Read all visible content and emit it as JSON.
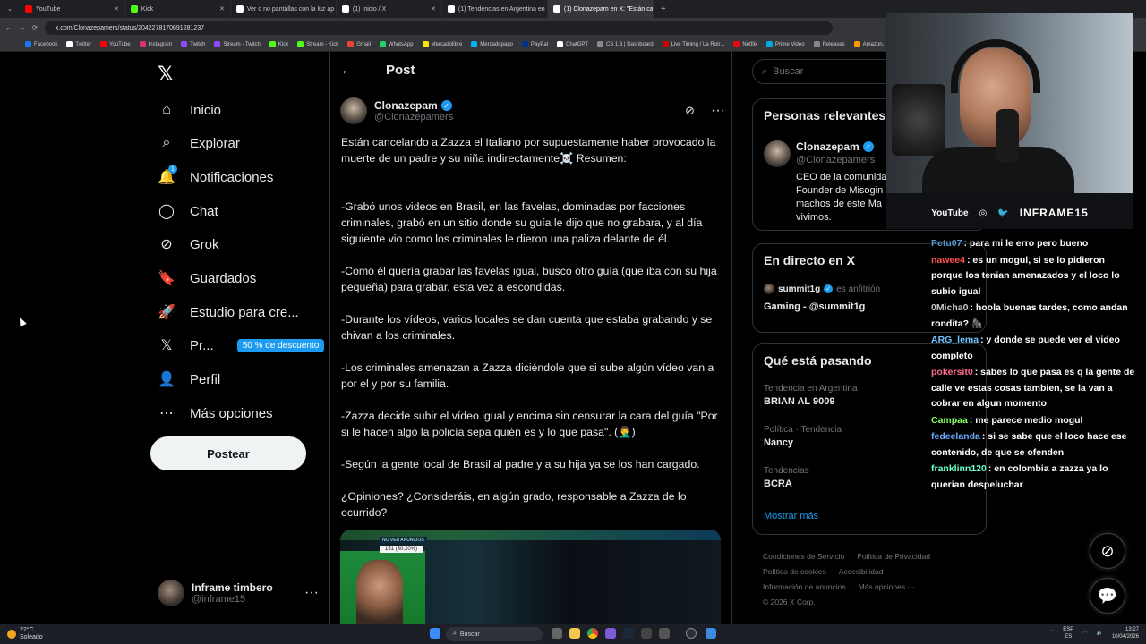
{
  "browser": {
    "tabs": [
      {
        "title": "YouTube",
        "color": "#ff0000",
        "active": false
      },
      {
        "title": "Kick",
        "color": "#53fc18",
        "active": false
      },
      {
        "title": "Ver o no pantallas con la luz ap",
        "color": "#ffffff",
        "active": false
      },
      {
        "title": "(1) Inicio / X",
        "color": "#ffffff",
        "active": false
      },
      {
        "title": "(1) Tendencias en Argentina en",
        "color": "#ffffff",
        "active": false
      },
      {
        "title": "(1) Clonazepam en X: \"Están ca",
        "color": "#ffffff",
        "active": true
      }
    ],
    "new_tab": "+",
    "url": "x.com/Clonazepamers/status/2042278170691281237",
    "bookmarks": [
      {
        "label": "Facebook",
        "color": "#1877f2"
      },
      {
        "label": "Twitter",
        "color": "#ffffff"
      },
      {
        "label": "YouTube",
        "color": "#ff0000"
      },
      {
        "label": "Instagram",
        "color": "#e1306c"
      },
      {
        "label": "Twitch",
        "color": "#9146ff"
      },
      {
        "label": "Stream - Twitch",
        "color": "#9146ff"
      },
      {
        "label": "Kick",
        "color": "#53fc18"
      },
      {
        "label": "Stream - Kick",
        "color": "#53fc18"
      },
      {
        "label": "Gmail",
        "color": "#ea4335"
      },
      {
        "label": "WhatsApp",
        "color": "#25d366"
      },
      {
        "label": "Mercadolibre",
        "color": "#ffe600"
      },
      {
        "label": "Mercadopago",
        "color": "#00b1ea"
      },
      {
        "label": "PayPal",
        "color": "#003087"
      },
      {
        "label": "ChatGPT",
        "color": "#ffffff"
      },
      {
        "label": "CS 1.6 | Dashboard",
        "color": "#888888"
      },
      {
        "label": "Live Timing / La Ron...",
        "color": "#cc0000"
      },
      {
        "label": "Netflix",
        "color": "#e50914"
      },
      {
        "label": "Prime Video",
        "color": "#00a8e1"
      },
      {
        "label": "Releases",
        "color": "#888888"
      },
      {
        "label": "Amazon.",
        "color": "#ff9900"
      },
      {
        "label": "JUAN",
        "color": "#ffffff"
      }
    ]
  },
  "sidebar": {
    "items": [
      {
        "label": "Inicio",
        "icon": "home-icon"
      },
      {
        "label": "Explorar",
        "icon": "search-icon"
      },
      {
        "label": "Notificaciones",
        "icon": "bell-icon",
        "badge": "1"
      },
      {
        "label": "Chat",
        "icon": "chat-icon"
      },
      {
        "label": "Grok",
        "icon": "grok-icon"
      },
      {
        "label": "Guardados",
        "icon": "bookmark-icon"
      },
      {
        "label": "Estudio para cre...",
        "icon": "rocket-icon"
      },
      {
        "label": "Pr...",
        "icon": "x-premium-icon",
        "promo": "50 % de descuento"
      },
      {
        "label": "Perfil",
        "icon": "user-icon"
      },
      {
        "label": "Más opciones",
        "icon": "more-circle-icon"
      }
    ],
    "post_button": "Postear",
    "profile": {
      "name": "Inframe timbero",
      "handle": "@inframe15",
      "more": "···"
    }
  },
  "post": {
    "header": "Post",
    "author": {
      "name": "Clonazepam",
      "handle": "@Clonazepamers"
    },
    "paragraphs": [
      "Están cancelando a Zazza el Italiano por supuestamente haber provocado la muerte de un padre y su niña indirectamente☠️ Resumen:",
      "-Grabó unos videos en Brasil, en las favelas, dominadas por facciones criminales, grabó en un sitio donde su guía le dijo que no grabara, y al día siguiente vio como los criminales  le dieron una paliza delante de él.",
      "-Como él quería grabar las favelas igual, busco otro guía (que iba con su hija pequeña) para grabar, esta vez a escondidas.",
      "-Durante los vídeos, varios locales se dan cuenta que estaba grabando y se chivan a los criminales.",
      "-Los criminales amenazan a Zazza diciéndole que si sube algún vídeo van a por el y por su familia.",
      "-Zazza decide subir el vídeo igual y encima sin censurar la cara del guía \"Por si le hacen algo la policía sepa quién es y lo que pasa\". (🤦‍♂️)",
      "-Según la gente local de Brasil al padre y a su hija ya se los han cargado.",
      "¿Opiniones? ¿Consideráis, en algún grado, responsable a Zazza de lo ocurrido?"
    ],
    "video": {
      "tag": "NO VER ANUNCIOS",
      "count": "151 (30.20%)"
    }
  },
  "right": {
    "search_placeholder": "Buscar",
    "relevant": {
      "title": "Personas relevantes",
      "name": "Clonazepam",
      "handle": "@Clonazepamers",
      "bio_lines": [
        "CEO de la comunida",
        "Founder de Misogin",
        "machos de este Ma",
        "vivimos."
      ]
    },
    "live": {
      "title": "En directo en X",
      "host": "summit1g",
      "host_label": "es anfitrión",
      "stream": "Gaming - @summit1g"
    },
    "whats_happening": {
      "title": "Qué está pasando",
      "trends": [
        {
          "context": "Tendencia en Argentina",
          "name": "BRIAN AL 9009"
        },
        {
          "context": "Política · Tendencia",
          "name": "Nancy"
        },
        {
          "context": "Tendencias",
          "name": "BCRA"
        }
      ],
      "show_more": "Mostrar más"
    },
    "footer": [
      "Condiciones de Servicio",
      "Política de Privacidad",
      "Política de cookies",
      "Accesibilidad",
      "Información de anuncios",
      "Más opciones ···",
      "© 2026 X Corp."
    ]
  },
  "webcam": {
    "footer_youtube": "YouTube",
    "footer_brand": "INFRAME15"
  },
  "chat": [
    {
      "user": "Petu07",
      "color": "#5b9bd5",
      "text": ": para mi le erro pero bueno"
    },
    {
      "user": "nawee4",
      "color": "#ff4f4f",
      "text": ": es un mogul, si se lo pidieron porque los tenian amenazados y el loco lo subio igual"
    },
    {
      "user": "0Micha0",
      "color": "#c8c8c8",
      "text": ": hoola buenas tardes, como andan rondita? 🦍"
    },
    {
      "user": "ARG_lema",
      "color": "#6fc3ff",
      "text": ": y donde se puede ver el video completo"
    },
    {
      "user": "pokersit0",
      "color": "#ff6b8a",
      "text": ": sabes lo que pasa es q la gente de calle ve estas cosas tambien, se la van a cobrar en algun momento"
    },
    {
      "user": "Campaa",
      "color": "#7fff5a",
      "text": ": me parece medio mogul"
    },
    {
      "user": "fedeelanda",
      "color": "#6aa8ff",
      "text": ": si se sabe que el loco hace ese contenido, de que se ofenden"
    },
    {
      "user": "franklinn120",
      "color": "#6fffc8",
      "text": ": en colombia a zazza ya lo querian despeluchar"
    }
  ],
  "taskbar": {
    "temp": "22°C",
    "condition": "Soleado",
    "search": "Buscar",
    "lang": "ESP",
    "lang_sub": "ES",
    "time": "13:27",
    "date": "10/04/2026"
  }
}
